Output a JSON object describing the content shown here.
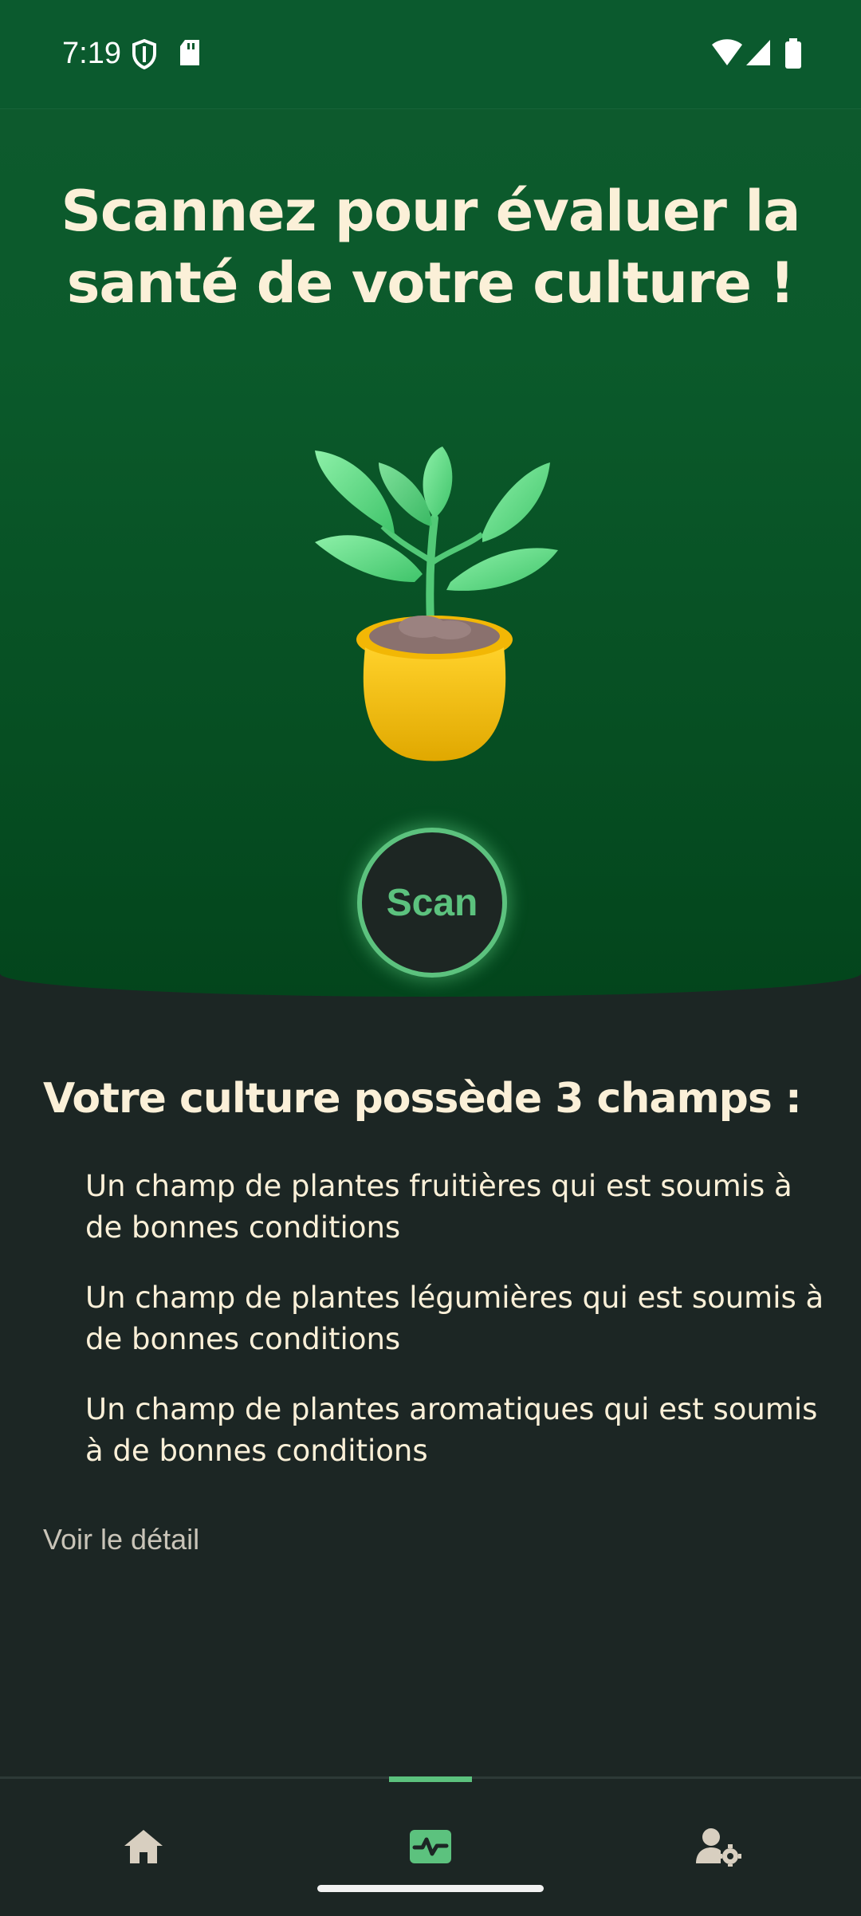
{
  "status_bar": {
    "time": "7:19"
  },
  "hero": {
    "headline_line1": "Scannez pour évaluer la",
    "headline_line2": "santé de votre culture !",
    "illustration": "potted-plant",
    "scan_label": "Scan"
  },
  "summary": {
    "title": "Votre culture possède 3 champs :",
    "fields": [
      "Un champ de plantes fruitières qui est soumis à de bonnes conditions",
      "Un champ de plantes légumières qui est soumis à de bonnes conditions",
      "Un champ de plantes aromatiques qui est soumis à de bonnes conditions"
    ],
    "detail_link": "Voir le détail"
  },
  "bottom_nav": {
    "items": [
      {
        "icon": "home-icon",
        "active": false
      },
      {
        "icon": "health-monitor-icon",
        "active": true
      },
      {
        "icon": "user-settings-icon",
        "active": false
      }
    ]
  },
  "colors": {
    "accent": "#5cc27e",
    "hero_green": "#0b5a2b",
    "background": "#1c2624",
    "cream_text": "#fbf0d8"
  }
}
